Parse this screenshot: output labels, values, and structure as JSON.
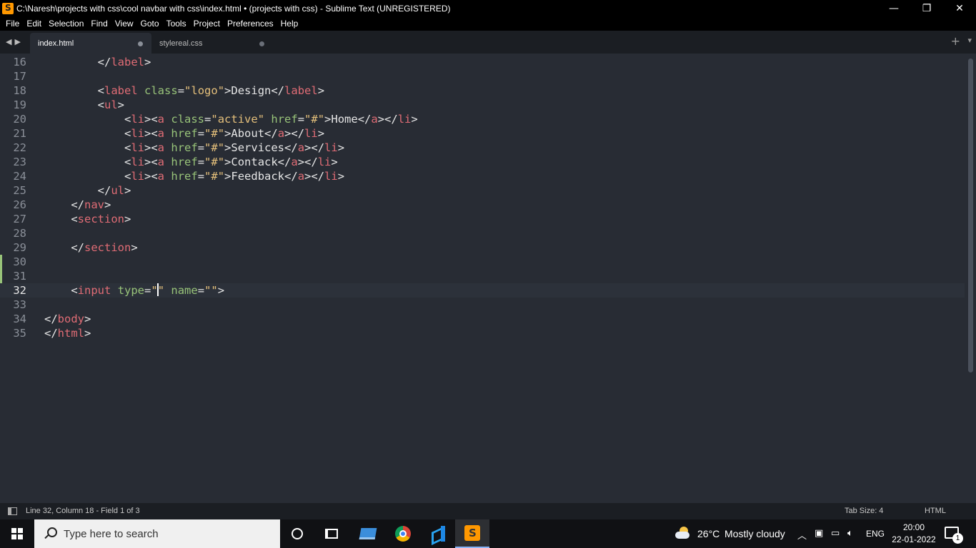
{
  "window": {
    "title": "C:\\Naresh\\projects with css\\cool navbar with css\\index.html • (projects with css) - Sublime Text (UNREGISTERED)",
    "minimize": "—",
    "maximize": "❐",
    "close": "✕"
  },
  "menu": [
    "File",
    "Edit",
    "Selection",
    "Find",
    "View",
    "Goto",
    "Tools",
    "Project",
    "Preferences",
    "Help"
  ],
  "tabs": [
    {
      "label": "index.html",
      "active": true
    },
    {
      "label": "stylereal.css",
      "active": false
    }
  ],
  "editor": {
    "lines": [
      {
        "n": "16",
        "tokens": [
          [
            "        ",
            "t-text"
          ],
          [
            "</",
            "t-punc"
          ],
          [
            "label",
            "t-tag"
          ],
          [
            ">",
            "t-punc"
          ]
        ]
      },
      {
        "n": "17",
        "tokens": []
      },
      {
        "n": "18",
        "tokens": [
          [
            "        ",
            "t-text"
          ],
          [
            "<",
            "t-punc"
          ],
          [
            "label",
            "t-tag"
          ],
          [
            " ",
            "t-text"
          ],
          [
            "class",
            "t-attr"
          ],
          [
            "=",
            "t-punc"
          ],
          [
            "\"logo\"",
            "t-str"
          ],
          [
            ">Design</",
            "t-punc"
          ],
          [
            "label",
            "t-tag"
          ],
          [
            ">",
            "t-punc"
          ]
        ]
      },
      {
        "n": "19",
        "tokens": [
          [
            "        ",
            "t-text"
          ],
          [
            "<",
            "t-punc"
          ],
          [
            "ul",
            "t-tag"
          ],
          [
            ">",
            "t-punc"
          ]
        ]
      },
      {
        "n": "20",
        "tokens": [
          [
            "            ",
            "t-text"
          ],
          [
            "<",
            "t-punc"
          ],
          [
            "li",
            "t-tag"
          ],
          [
            "><",
            "t-punc"
          ],
          [
            "a",
            "t-tag"
          ],
          [
            " ",
            "t-text"
          ],
          [
            "class",
            "t-attr"
          ],
          [
            "=",
            "t-punc"
          ],
          [
            "\"active\"",
            "t-str"
          ],
          [
            " ",
            "t-text"
          ],
          [
            "href",
            "t-attr"
          ],
          [
            "=",
            "t-punc"
          ],
          [
            "\"#\"",
            "t-str"
          ],
          [
            ">Home</",
            "t-punc"
          ],
          [
            "a",
            "t-tag"
          ],
          [
            "></",
            "t-punc"
          ],
          [
            "li",
            "t-tag"
          ],
          [
            ">",
            "t-punc"
          ]
        ]
      },
      {
        "n": "21",
        "tokens": [
          [
            "            ",
            "t-text"
          ],
          [
            "<",
            "t-punc"
          ],
          [
            "li",
            "t-tag"
          ],
          [
            "><",
            "t-punc"
          ],
          [
            "a",
            "t-tag"
          ],
          [
            " ",
            "t-text"
          ],
          [
            "href",
            "t-attr"
          ],
          [
            "=",
            "t-punc"
          ],
          [
            "\"#\"",
            "t-str"
          ],
          [
            ">About</",
            "t-punc"
          ],
          [
            "a",
            "t-tag"
          ],
          [
            "></",
            "t-punc"
          ],
          [
            "li",
            "t-tag"
          ],
          [
            ">",
            "t-punc"
          ]
        ]
      },
      {
        "n": "22",
        "tokens": [
          [
            "            ",
            "t-text"
          ],
          [
            "<",
            "t-punc"
          ],
          [
            "li",
            "t-tag"
          ],
          [
            "><",
            "t-punc"
          ],
          [
            "a",
            "t-tag"
          ],
          [
            " ",
            "t-text"
          ],
          [
            "href",
            "t-attr"
          ],
          [
            "=",
            "t-punc"
          ],
          [
            "\"#\"",
            "t-str"
          ],
          [
            ">Services</",
            "t-punc"
          ],
          [
            "a",
            "t-tag"
          ],
          [
            "></",
            "t-punc"
          ],
          [
            "li",
            "t-tag"
          ],
          [
            ">",
            "t-punc"
          ]
        ]
      },
      {
        "n": "23",
        "tokens": [
          [
            "            ",
            "t-text"
          ],
          [
            "<",
            "t-punc"
          ],
          [
            "li",
            "t-tag"
          ],
          [
            "><",
            "t-punc"
          ],
          [
            "a",
            "t-tag"
          ],
          [
            " ",
            "t-text"
          ],
          [
            "href",
            "t-attr"
          ],
          [
            "=",
            "t-punc"
          ],
          [
            "\"#\"",
            "t-str"
          ],
          [
            ">Contack</",
            "t-punc"
          ],
          [
            "a",
            "t-tag"
          ],
          [
            "></",
            "t-punc"
          ],
          [
            "li",
            "t-tag"
          ],
          [
            ">",
            "t-punc"
          ]
        ]
      },
      {
        "n": "24",
        "tokens": [
          [
            "            ",
            "t-text"
          ],
          [
            "<",
            "t-punc"
          ],
          [
            "li",
            "t-tag"
          ],
          [
            "><",
            "t-punc"
          ],
          [
            "a",
            "t-tag"
          ],
          [
            " ",
            "t-text"
          ],
          [
            "href",
            "t-attr"
          ],
          [
            "=",
            "t-punc"
          ],
          [
            "\"#\"",
            "t-str"
          ],
          [
            ">Feedback</",
            "t-punc"
          ],
          [
            "a",
            "t-tag"
          ],
          [
            "></",
            "t-punc"
          ],
          [
            "li",
            "t-tag"
          ],
          [
            ">",
            "t-punc"
          ]
        ]
      },
      {
        "n": "25",
        "tokens": [
          [
            "        ",
            "t-text"
          ],
          [
            "</",
            "t-punc"
          ],
          [
            "ul",
            "t-tag"
          ],
          [
            ">",
            "t-punc"
          ]
        ]
      },
      {
        "n": "26",
        "tokens": [
          [
            "    ",
            "t-text"
          ],
          [
            "</",
            "t-punc"
          ],
          [
            "nav",
            "t-tag"
          ],
          [
            ">",
            "t-punc"
          ]
        ]
      },
      {
        "n": "27",
        "tokens": [
          [
            "    ",
            "t-text"
          ],
          [
            "<",
            "t-punc"
          ],
          [
            "section",
            "t-tag"
          ],
          [
            ">",
            "t-punc"
          ]
        ]
      },
      {
        "n": "28",
        "tokens": []
      },
      {
        "n": "29",
        "tokens": [
          [
            "    ",
            "t-text"
          ],
          [
            "</",
            "t-punc"
          ],
          [
            "section",
            "t-tag"
          ],
          [
            ">",
            "t-punc"
          ]
        ]
      },
      {
        "n": "30",
        "tokens": [],
        "modified": true
      },
      {
        "n": "31",
        "tokens": [],
        "modified": true
      },
      {
        "n": "32",
        "tokens": [
          [
            "    ",
            "t-text"
          ],
          [
            "<",
            "t-punc"
          ],
          [
            "input",
            "t-tag"
          ],
          [
            " ",
            "t-text"
          ],
          [
            "type",
            "t-attr"
          ],
          [
            "=",
            "t-punc"
          ],
          [
            "\"",
            "t-str"
          ],
          [
            "|caret|",
            "caret"
          ],
          [
            "\"",
            "t-str"
          ],
          [
            " ",
            "t-text"
          ],
          [
            "name",
            "t-attr"
          ],
          [
            "=",
            "t-punc"
          ],
          [
            "\"\"",
            "t-str"
          ],
          [
            ">",
            "t-punc"
          ]
        ],
        "modified": true,
        "current": true
      },
      {
        "n": "33",
        "tokens": []
      },
      {
        "n": "34",
        "tokens": [
          [
            "</",
            "t-punc"
          ],
          [
            "body",
            "t-tag"
          ],
          [
            ">",
            "t-punc"
          ]
        ]
      },
      {
        "n": "35",
        "tokens": [
          [
            "</",
            "t-punc"
          ],
          [
            "html",
            "t-tag"
          ],
          [
            ">",
            "t-punc"
          ]
        ]
      }
    ]
  },
  "status": {
    "position": "Line 32, Column 18 - Field 1 of 3",
    "tab_size": "Tab Size: 4",
    "syntax": "HTML"
  },
  "taskbar": {
    "search_placeholder": "Type here to search",
    "temperature": "26°C",
    "weather": "Mostly cloudy",
    "language": "ENG",
    "time": "20:00",
    "date": "22-01-2022",
    "notification_count": "1"
  },
  "colors": {
    "tag": "#e06c75",
    "attribute": "#98c379",
    "string": "#e5c07b",
    "editor_bg": "#282c34",
    "modified_marker": "#98c379"
  }
}
